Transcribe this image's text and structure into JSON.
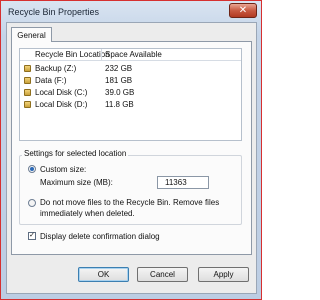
{
  "window": {
    "title": "Recycle Bin Properties",
    "close_glyph": "✕",
    "close_icon": "close-icon"
  },
  "tabs": [
    {
      "label": "General"
    }
  ],
  "list": {
    "headers": [
      "Recycle Bin Location",
      "Space Available"
    ],
    "rows": [
      {
        "name": "Backup (Z:)",
        "space": "232 GB",
        "icon": "drive-icon"
      },
      {
        "name": "Data (F:)",
        "space": "181 GB",
        "icon": "drive-icon"
      },
      {
        "name": "Local Disk (C:)",
        "space": "39.0 GB",
        "icon": "drive-icon"
      },
      {
        "name": "Local Disk (D:)",
        "space": "11.8 GB",
        "icon": "drive-icon"
      }
    ]
  },
  "settings": {
    "group_title": "Settings for selected location",
    "custom_size_label": "Custom size:",
    "max_size_label": "Maximum size (MB):",
    "max_size_value": "11363",
    "no_move_line1": "Do not move files to the Recycle Bin. Remove files",
    "no_move_line2": "immediately when deleted."
  },
  "confirm": {
    "label": "Display delete confirmation dialog",
    "checked": true,
    "check_glyph": "✓"
  },
  "buttons": {
    "ok": "OK",
    "cancel": "Cancel",
    "apply": "Apply"
  }
}
